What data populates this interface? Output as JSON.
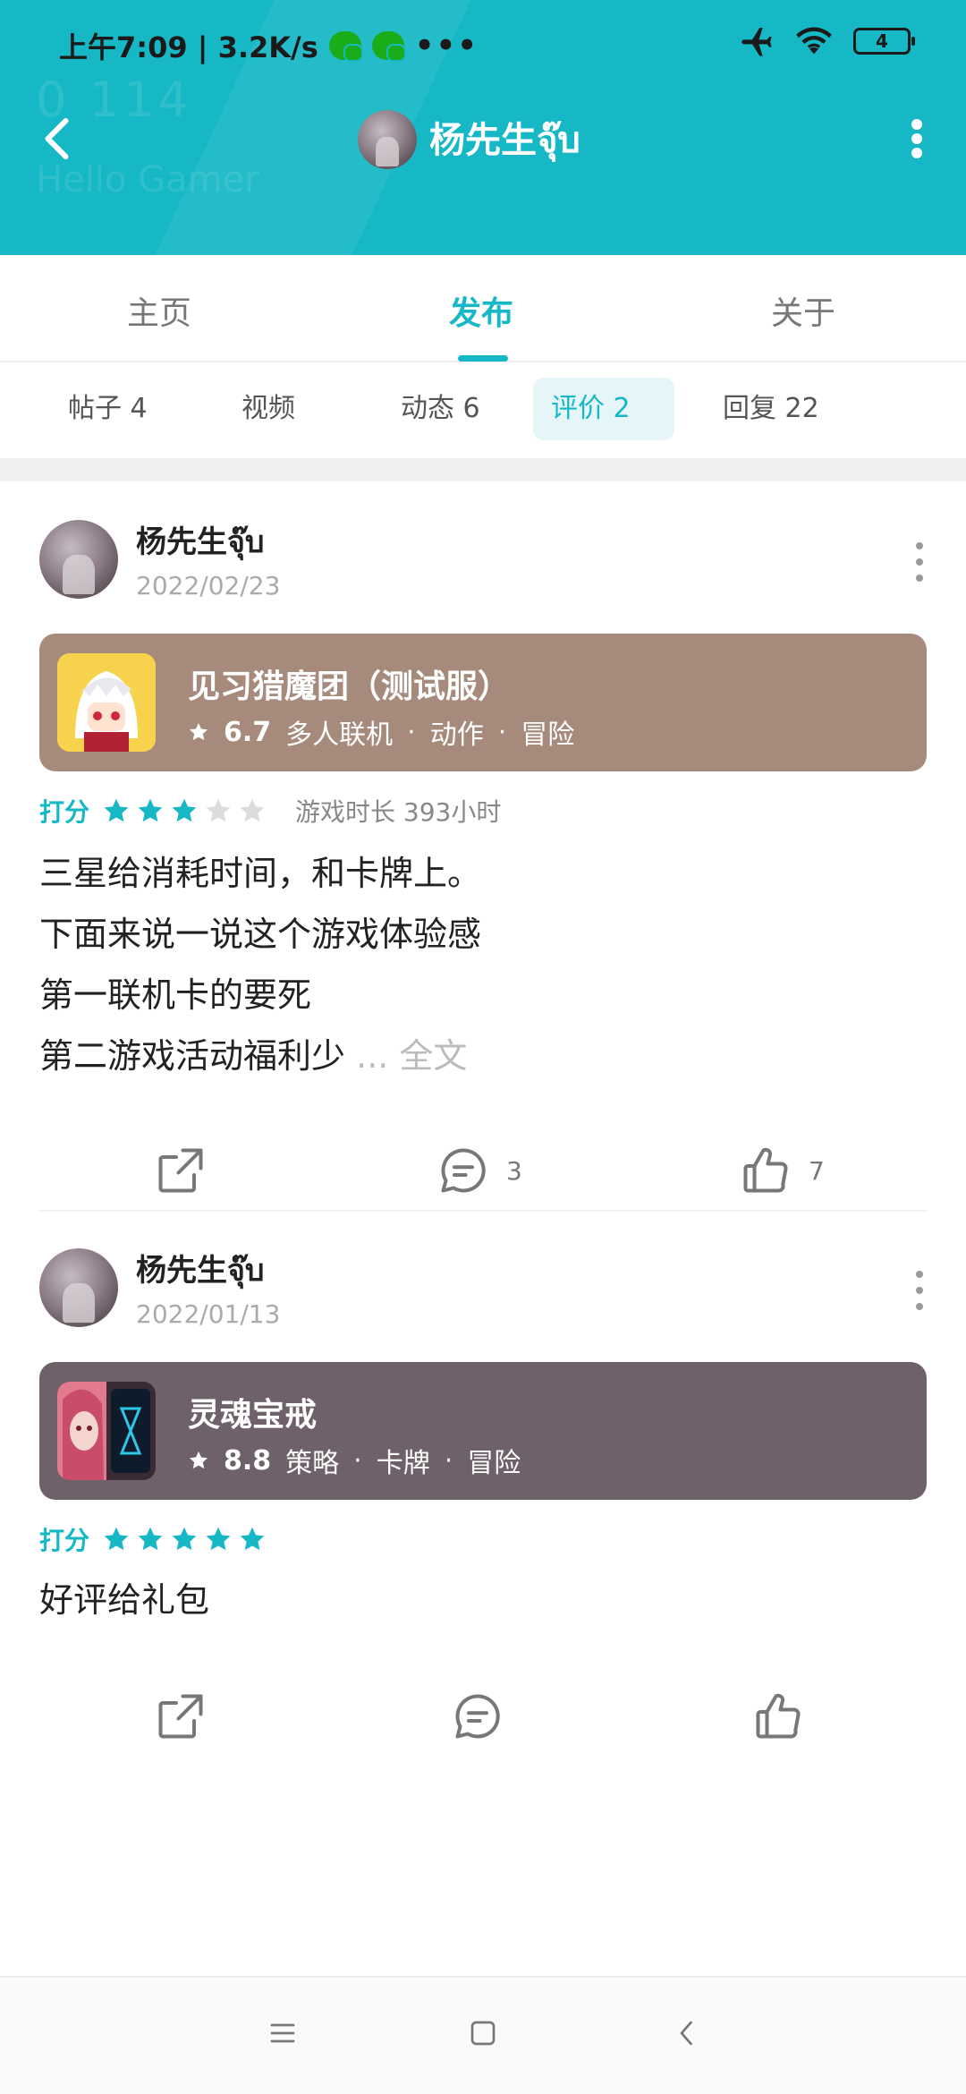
{
  "status_bar": {
    "time_speed": "上午7:09 | 3.2K/s",
    "more": "•••",
    "battery": "4"
  },
  "header": {
    "deco_line1": "0  114",
    "deco_line2": "Hello Gamer",
    "user_name": "杨先生จุ๊บ",
    "accent_color": "#17b8c6"
  },
  "tabs": [
    {
      "label": "主页"
    },
    {
      "label": "发布"
    },
    {
      "label": "关于"
    }
  ],
  "subtabs": [
    {
      "label": "帖子 4"
    },
    {
      "label": "视频"
    },
    {
      "label": "动态 6"
    },
    {
      "label": "评价 2"
    },
    {
      "label": "回复 22"
    }
  ],
  "posts": [
    {
      "author": "杨先生จุ๊บ",
      "date": "2022/02/23",
      "game": {
        "title": "见习猎魔团（测试服）",
        "score": "6.7",
        "tags": [
          "多人联机",
          "动作",
          "冒险"
        ],
        "card_color": "#a68b7d"
      },
      "rating_label": "打分",
      "stars": 3,
      "playtime": "游戏时长 393小时",
      "lines": [
        "三星给消耗时间，和卡牌上。",
        "下面来说一说这个游戏体验感",
        "第一联机卡的要死",
        "第二游戏活动福利少"
      ],
      "more_link": "... 全文",
      "comments": "3",
      "likes": "7"
    },
    {
      "author": "杨先生จุ๊บ",
      "date": "2022/01/13",
      "game": {
        "title": "灵魂宝戒",
        "score": "8.8",
        "tags": [
          "策略",
          "卡牌",
          "冒险"
        ],
        "card_color": "#6e6169"
      },
      "rating_label": "打分",
      "stars": 5,
      "lines": [
        "好评给礼包"
      ]
    }
  ]
}
